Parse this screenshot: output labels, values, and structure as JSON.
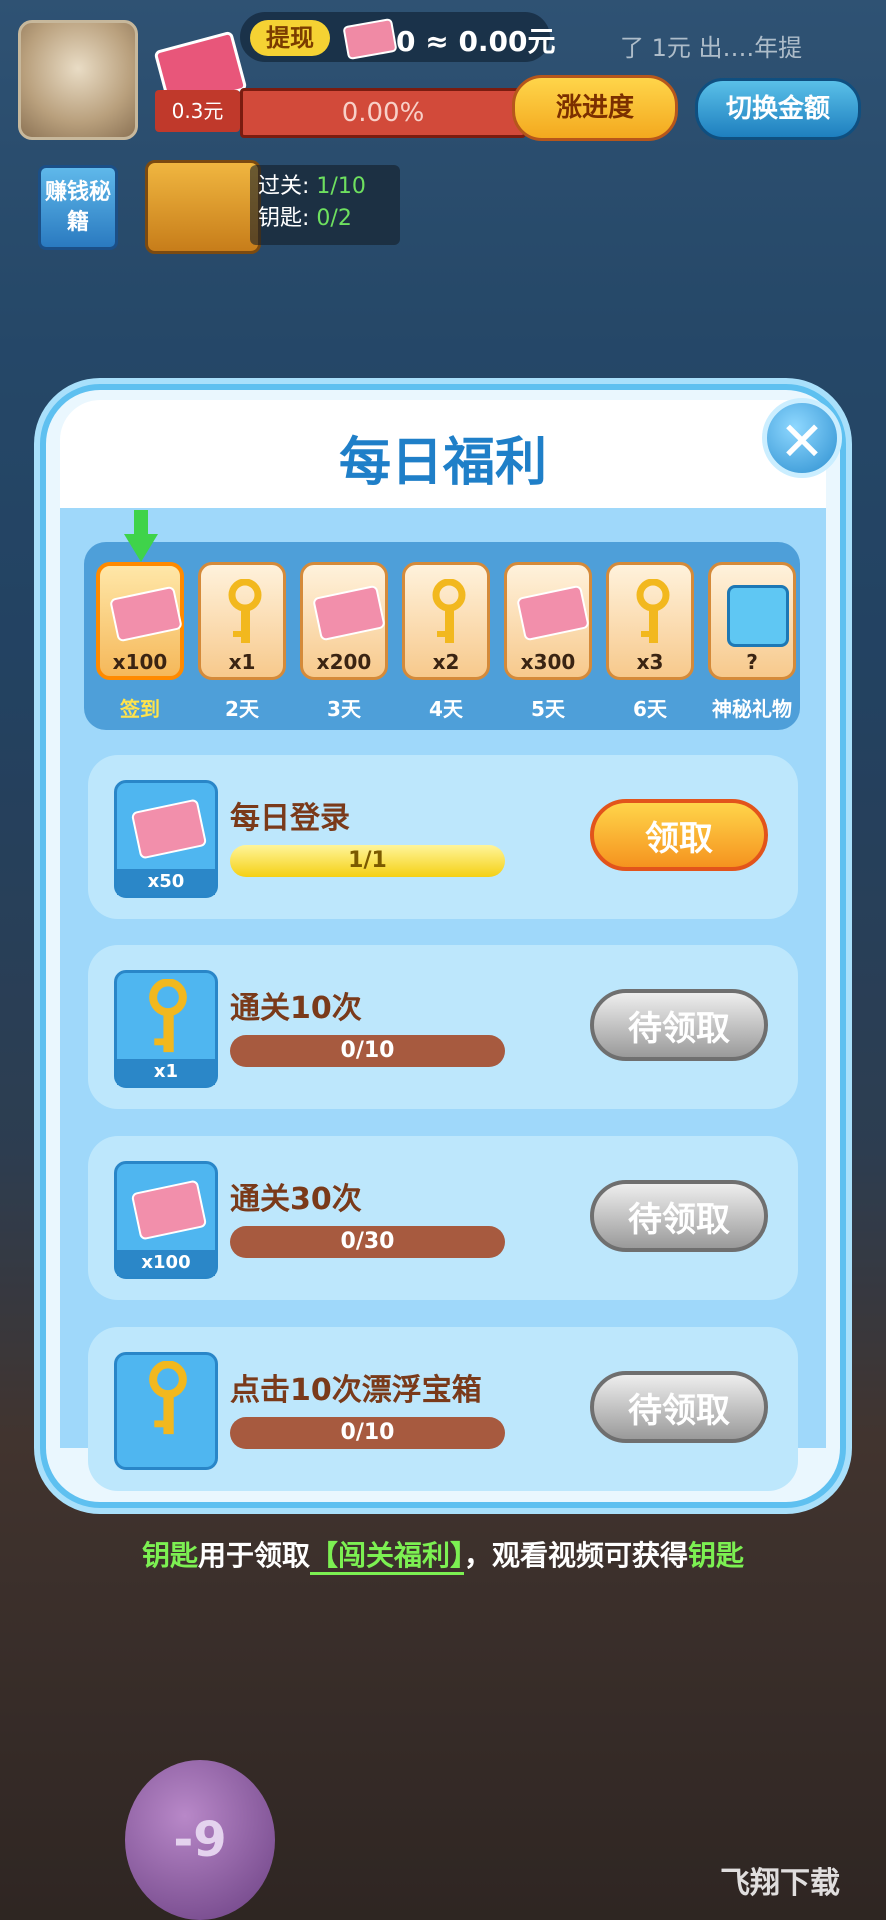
{
  "hud": {
    "withdraw_label": "提现",
    "balance_text": "0 ≈ 0.00元",
    "top_right_text": "了 1元  出….年提",
    "progress_left": "0.3元",
    "progress_percent": "0.00%",
    "progress_value": 0.0,
    "boost_button": "涨进度",
    "switch_button": "切换金额",
    "guide_label": "赚钱秘籍",
    "level_text": "过关: ",
    "level_value": "1/10",
    "keys_text": "钥匙: ",
    "keys_value": "0/2"
  },
  "modal": {
    "title": "每日福利",
    "close_label": "✕"
  },
  "week": [
    {
      "qty": "x100",
      "label": "签到",
      "reward": "cash-icon",
      "active": true
    },
    {
      "qty": "x1",
      "label": "2天",
      "reward": "key-icon",
      "active": false
    },
    {
      "qty": "x200",
      "label": "3天",
      "reward": "cash-icon",
      "active": false
    },
    {
      "qty": "x2",
      "label": "4天",
      "reward": "key-icon",
      "active": false
    },
    {
      "qty": "x300",
      "label": "5天",
      "reward": "cash-icon",
      "active": false
    },
    {
      "qty": "x3",
      "label": "6天",
      "reward": "key-icon",
      "active": false
    },
    {
      "qty": "?",
      "label": "神秘礼物",
      "reward": "gift-icon",
      "active": false
    }
  ],
  "tasks": [
    {
      "title": "每日登录",
      "qty": "x50",
      "progress": "1/1",
      "button": "领取",
      "state": "claim",
      "reward": "cash-icon"
    },
    {
      "title": "通关10次",
      "qty": "x1",
      "progress": "0/10",
      "button": "待领取",
      "state": "wait",
      "reward": "key-icon"
    },
    {
      "title": "通关30次",
      "qty": "x100",
      "progress": "0/30",
      "button": "待领取",
      "state": "wait",
      "reward": "cash-icon"
    },
    {
      "title": "点击10次漂浮宝箱",
      "qty": "",
      "progress": "0/10",
      "button": "待领取",
      "state": "wait",
      "reward": "key-icon"
    }
  ],
  "footer": {
    "part1": "钥匙",
    "part2": "用于领取",
    "part3": "【闯关福利】",
    "part4": "，观看视频可获得",
    "part5": "钥匙"
  },
  "balloon_text": "-9",
  "watermark": "飞翔下载"
}
